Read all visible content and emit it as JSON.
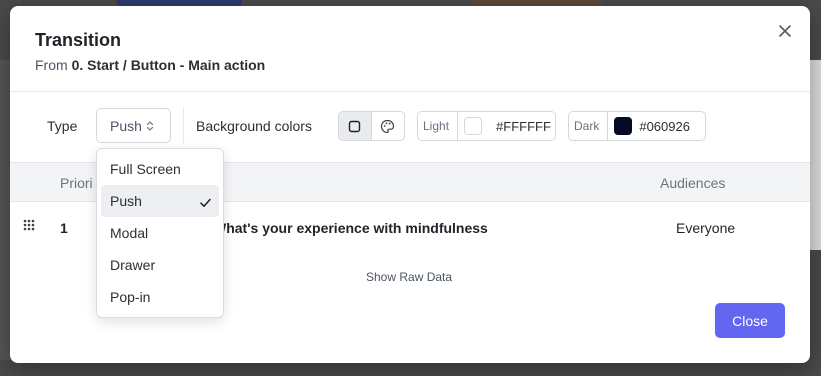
{
  "modal": {
    "title": "Transition",
    "subtitle_prefix": "From",
    "subtitle_path": "0. Start / Button - Main action"
  },
  "toolbar": {
    "type_label": "Type",
    "type_value": "Push",
    "background_label": "Background colors",
    "light": {
      "label": "Light",
      "hex": "#FFFFFF",
      "swatch": "#FFFFFF"
    },
    "dark": {
      "label": "Dark",
      "hex": "#060926",
      "swatch": "#060926"
    }
  },
  "table": {
    "headers": {
      "priority": "Priori",
      "audiences": "Audiences"
    },
    "rows": [
      {
        "priority": "1",
        "name": "What's your experience with mindfulness",
        "audience": "Everyone"
      }
    ]
  },
  "raw_data_link": "Show Raw Data",
  "close_button": "Close",
  "dropdown": {
    "options": [
      "Full Screen",
      "Push",
      "Modal",
      "Drawer",
      "Pop-in"
    ],
    "selected": "Push"
  },
  "icons": {
    "close": "close-icon",
    "chevron": "chevron-updown-icon",
    "square": "square-icon",
    "palette": "palette-icon",
    "grip": "grip-icon",
    "check": "check-icon"
  },
  "colors": {
    "accent": "#6366F1",
    "overlay": "#4A4A4A"
  }
}
